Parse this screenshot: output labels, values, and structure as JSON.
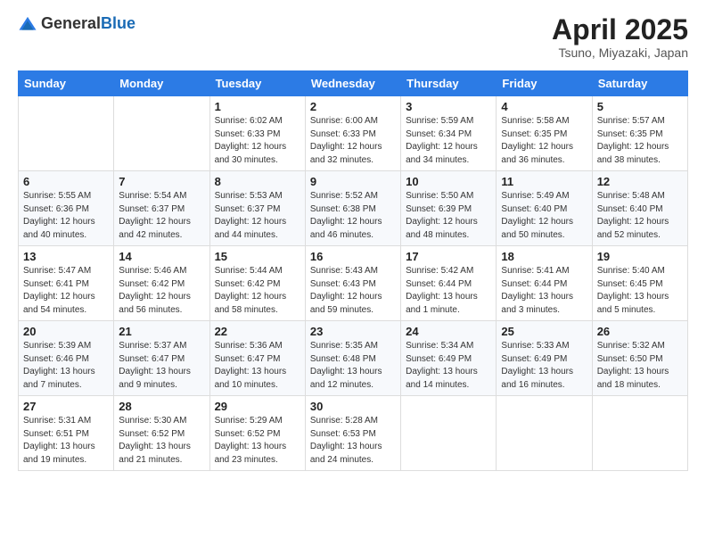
{
  "header": {
    "logo_general": "General",
    "logo_blue": "Blue",
    "title": "April 2025",
    "subtitle": "Tsuno, Miyazaki, Japan"
  },
  "calendar": {
    "days_of_week": [
      "Sunday",
      "Monday",
      "Tuesday",
      "Wednesday",
      "Thursday",
      "Friday",
      "Saturday"
    ],
    "weeks": [
      [
        {
          "day": "",
          "info": ""
        },
        {
          "day": "",
          "info": ""
        },
        {
          "day": "1",
          "info": "Sunrise: 6:02 AM\nSunset: 6:33 PM\nDaylight: 12 hours and 30 minutes."
        },
        {
          "day": "2",
          "info": "Sunrise: 6:00 AM\nSunset: 6:33 PM\nDaylight: 12 hours and 32 minutes."
        },
        {
          "day": "3",
          "info": "Sunrise: 5:59 AM\nSunset: 6:34 PM\nDaylight: 12 hours and 34 minutes."
        },
        {
          "day": "4",
          "info": "Sunrise: 5:58 AM\nSunset: 6:35 PM\nDaylight: 12 hours and 36 minutes."
        },
        {
          "day": "5",
          "info": "Sunrise: 5:57 AM\nSunset: 6:35 PM\nDaylight: 12 hours and 38 minutes."
        }
      ],
      [
        {
          "day": "6",
          "info": "Sunrise: 5:55 AM\nSunset: 6:36 PM\nDaylight: 12 hours and 40 minutes."
        },
        {
          "day": "7",
          "info": "Sunrise: 5:54 AM\nSunset: 6:37 PM\nDaylight: 12 hours and 42 minutes."
        },
        {
          "day": "8",
          "info": "Sunrise: 5:53 AM\nSunset: 6:37 PM\nDaylight: 12 hours and 44 minutes."
        },
        {
          "day": "9",
          "info": "Sunrise: 5:52 AM\nSunset: 6:38 PM\nDaylight: 12 hours and 46 minutes."
        },
        {
          "day": "10",
          "info": "Sunrise: 5:50 AM\nSunset: 6:39 PM\nDaylight: 12 hours and 48 minutes."
        },
        {
          "day": "11",
          "info": "Sunrise: 5:49 AM\nSunset: 6:40 PM\nDaylight: 12 hours and 50 minutes."
        },
        {
          "day": "12",
          "info": "Sunrise: 5:48 AM\nSunset: 6:40 PM\nDaylight: 12 hours and 52 minutes."
        }
      ],
      [
        {
          "day": "13",
          "info": "Sunrise: 5:47 AM\nSunset: 6:41 PM\nDaylight: 12 hours and 54 minutes."
        },
        {
          "day": "14",
          "info": "Sunrise: 5:46 AM\nSunset: 6:42 PM\nDaylight: 12 hours and 56 minutes."
        },
        {
          "day": "15",
          "info": "Sunrise: 5:44 AM\nSunset: 6:42 PM\nDaylight: 12 hours and 58 minutes."
        },
        {
          "day": "16",
          "info": "Sunrise: 5:43 AM\nSunset: 6:43 PM\nDaylight: 12 hours and 59 minutes."
        },
        {
          "day": "17",
          "info": "Sunrise: 5:42 AM\nSunset: 6:44 PM\nDaylight: 13 hours and 1 minute."
        },
        {
          "day": "18",
          "info": "Sunrise: 5:41 AM\nSunset: 6:44 PM\nDaylight: 13 hours and 3 minutes."
        },
        {
          "day": "19",
          "info": "Sunrise: 5:40 AM\nSunset: 6:45 PM\nDaylight: 13 hours and 5 minutes."
        }
      ],
      [
        {
          "day": "20",
          "info": "Sunrise: 5:39 AM\nSunset: 6:46 PM\nDaylight: 13 hours and 7 minutes."
        },
        {
          "day": "21",
          "info": "Sunrise: 5:37 AM\nSunset: 6:47 PM\nDaylight: 13 hours and 9 minutes."
        },
        {
          "day": "22",
          "info": "Sunrise: 5:36 AM\nSunset: 6:47 PM\nDaylight: 13 hours and 10 minutes."
        },
        {
          "day": "23",
          "info": "Sunrise: 5:35 AM\nSunset: 6:48 PM\nDaylight: 13 hours and 12 minutes."
        },
        {
          "day": "24",
          "info": "Sunrise: 5:34 AM\nSunset: 6:49 PM\nDaylight: 13 hours and 14 minutes."
        },
        {
          "day": "25",
          "info": "Sunrise: 5:33 AM\nSunset: 6:49 PM\nDaylight: 13 hours and 16 minutes."
        },
        {
          "day": "26",
          "info": "Sunrise: 5:32 AM\nSunset: 6:50 PM\nDaylight: 13 hours and 18 minutes."
        }
      ],
      [
        {
          "day": "27",
          "info": "Sunrise: 5:31 AM\nSunset: 6:51 PM\nDaylight: 13 hours and 19 minutes."
        },
        {
          "day": "28",
          "info": "Sunrise: 5:30 AM\nSunset: 6:52 PM\nDaylight: 13 hours and 21 minutes."
        },
        {
          "day": "29",
          "info": "Sunrise: 5:29 AM\nSunset: 6:52 PM\nDaylight: 13 hours and 23 minutes."
        },
        {
          "day": "30",
          "info": "Sunrise: 5:28 AM\nSunset: 6:53 PM\nDaylight: 13 hours and 24 minutes."
        },
        {
          "day": "",
          "info": ""
        },
        {
          "day": "",
          "info": ""
        },
        {
          "day": "",
          "info": ""
        }
      ]
    ]
  }
}
